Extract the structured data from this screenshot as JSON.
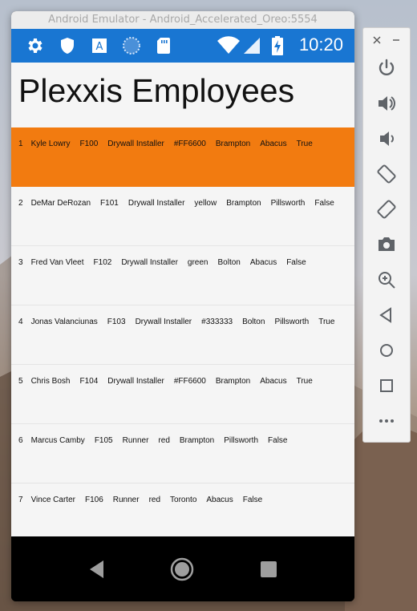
{
  "window": {
    "title": "Android Emulator - Android_Accelerated_Oreo:5554"
  },
  "statusbar": {
    "time": "10:20",
    "bg": "#1976d2"
  },
  "app": {
    "title": "Plexxis Employees",
    "selected_color": "#f27b10",
    "employees": [
      {
        "id": "1",
        "name": "Kyle Lowry",
        "code": "F100",
        "profession": "Drywall Installer",
        "color": "#FF6600",
        "city": "Brampton",
        "branch": "Abacus",
        "assigned": "True"
      },
      {
        "id": "2",
        "name": "DeMar DeRozan",
        "code": "F101",
        "profession": "Drywall Installer",
        "color": "yellow",
        "city": "Brampton",
        "branch": "Pillsworth",
        "assigned": "False"
      },
      {
        "id": "3",
        "name": "Fred Van Vleet",
        "code": "F102",
        "profession": "Drywall Installer",
        "color": "green",
        "city": "Bolton",
        "branch": "Abacus",
        "assigned": "False"
      },
      {
        "id": "4",
        "name": "Jonas Valanciunas",
        "code": "F103",
        "profession": "Drywall Installer",
        "color": "#333333",
        "city": "Bolton",
        "branch": "Pillsworth",
        "assigned": "True"
      },
      {
        "id": "5",
        "name": "Chris Bosh",
        "code": "F104",
        "profession": "Drywall Installer",
        "color": "#FF6600",
        "city": "Brampton",
        "branch": "Abacus",
        "assigned": "True"
      },
      {
        "id": "6",
        "name": "Marcus Camby",
        "code": "F105",
        "profession": "Runner",
        "color": "red",
        "city": "Brampton",
        "branch": "Pillsworth",
        "assigned": "False"
      },
      {
        "id": "7",
        "name": "Vince Carter",
        "code": "F106",
        "profession": "Runner",
        "color": "red",
        "city": "Toronto",
        "branch": "Abacus",
        "assigned": "False"
      }
    ]
  },
  "icons": {
    "statusbar": [
      "settings-icon",
      "shield-icon",
      "accessibility-a-icon",
      "loading-circle-icon",
      "sd-card-icon",
      "wifi-icon",
      "cellular-icon",
      "battery-charging-icon"
    ],
    "navbar": [
      "back-icon",
      "home-icon",
      "recents-icon"
    ],
    "panel": [
      "close-icon",
      "minimize-icon",
      "power-icon",
      "volume-up-icon",
      "volume-down-icon",
      "rotate-left-icon",
      "rotate-right-icon",
      "camera-icon",
      "zoom-icon",
      "back-icon",
      "home-icon",
      "overview-icon",
      "more-icon"
    ]
  }
}
